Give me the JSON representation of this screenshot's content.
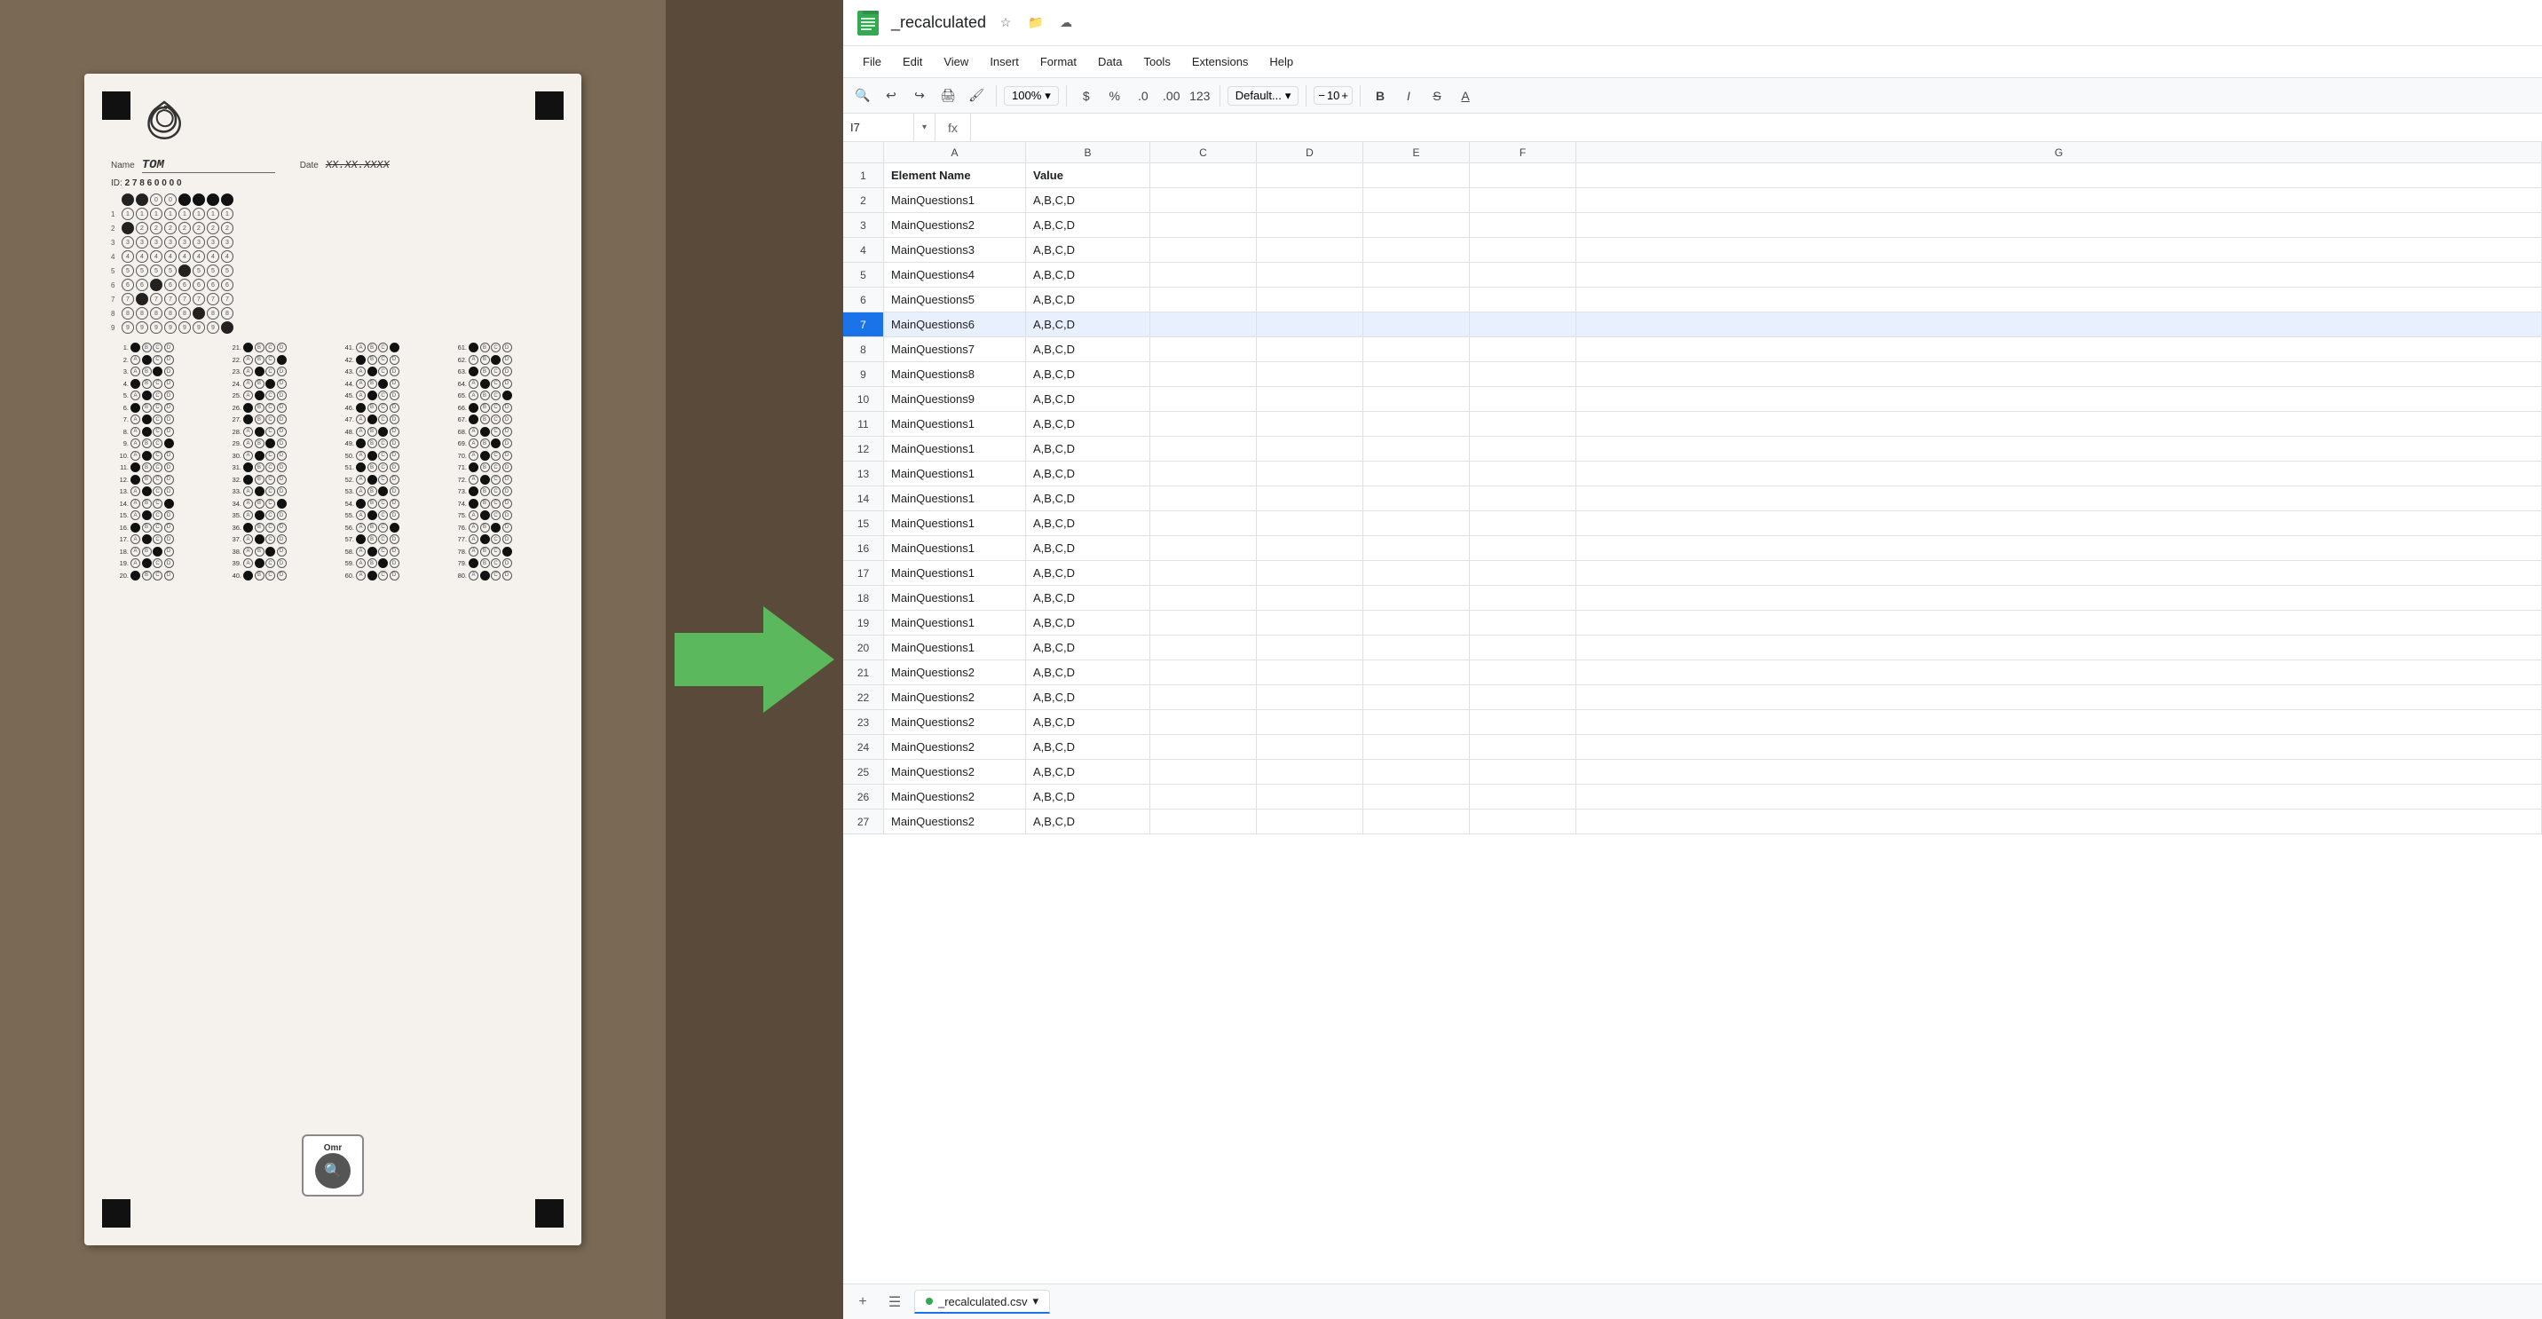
{
  "left_panel": {
    "name_label": "Name",
    "name_value": "TOM",
    "date_label": "Date",
    "date_value": "XX.XX.XXXX",
    "id_label": "ID:",
    "id_digits": "27860000"
  },
  "arrow": {
    "color": "#5cb85c"
  },
  "spreadsheet": {
    "title": "_recalculated",
    "file_name": "_recalculated.csv",
    "cell_ref": "I7",
    "menu": [
      "File",
      "Edit",
      "View",
      "Insert",
      "Format",
      "Data",
      "Tools",
      "Extensions",
      "Help"
    ],
    "toolbar": {
      "zoom": "100%",
      "font": "Default...",
      "font_size": "10",
      "bold": "B",
      "italic": "I",
      "strikethrough": "S",
      "underline": "U"
    },
    "columns": [
      "",
      "A",
      "B",
      "C",
      "D",
      "E",
      "F",
      "G"
    ],
    "rows": [
      {
        "num": 1,
        "a": "Element Name",
        "b": "Value"
      },
      {
        "num": 2,
        "a": "MainQuestions1",
        "b": "A,B,C,D"
      },
      {
        "num": 3,
        "a": "MainQuestions2",
        "b": "A,B,C,D"
      },
      {
        "num": 4,
        "a": "MainQuestions3",
        "b": "A,B,C,D"
      },
      {
        "num": 5,
        "a": "MainQuestions4",
        "b": "A,B,C,D"
      },
      {
        "num": 6,
        "a": "MainQuestions5",
        "b": "A,B,C,D"
      },
      {
        "num": 7,
        "a": "MainQuestions6",
        "b": "A,B,C,D",
        "selected": true
      },
      {
        "num": 8,
        "a": "MainQuestions7",
        "b": "A,B,C,D"
      },
      {
        "num": 9,
        "a": "MainQuestions8",
        "b": "A,B,C,D"
      },
      {
        "num": 10,
        "a": "MainQuestions9",
        "b": "A,B,C,D"
      },
      {
        "num": 11,
        "a": "MainQuestions1",
        "b": "A,B,C,D"
      },
      {
        "num": 12,
        "a": "MainQuestions1",
        "b": "A,B,C,D"
      },
      {
        "num": 13,
        "a": "MainQuestions1",
        "b": "A,B,C,D"
      },
      {
        "num": 14,
        "a": "MainQuestions1",
        "b": "A,B,C,D"
      },
      {
        "num": 15,
        "a": "MainQuestions1",
        "b": "A,B,C,D"
      },
      {
        "num": 16,
        "a": "MainQuestions1",
        "b": "A,B,C,D"
      },
      {
        "num": 17,
        "a": "MainQuestions1",
        "b": "A,B,C,D"
      },
      {
        "num": 18,
        "a": "MainQuestions1",
        "b": "A,B,C,D"
      },
      {
        "num": 19,
        "a": "MainQuestions1",
        "b": "A,B,C,D"
      },
      {
        "num": 20,
        "a": "MainQuestions1",
        "b": "A,B,C,D"
      },
      {
        "num": 21,
        "a": "MainQuestions2",
        "b": "A,B,C,D"
      },
      {
        "num": 22,
        "a": "MainQuestions2",
        "b": "A,B,C,D"
      },
      {
        "num": 23,
        "a": "MainQuestions2",
        "b": "A,B,C,D"
      },
      {
        "num": 24,
        "a": "MainQuestions2",
        "b": "A,B,C,D"
      },
      {
        "num": 25,
        "a": "MainQuestions2",
        "b": "A,B,C,D"
      },
      {
        "num": 26,
        "a": "MainQuestions2",
        "b": "A,B,C,D"
      },
      {
        "num": 27,
        "a": "MainQuestions2",
        "b": "A,B,C,D"
      }
    ]
  },
  "omr_watermark": "Omr",
  "questions": {
    "col1": [
      {
        "num": "1.",
        "bubbles": [
          "filled",
          "",
          "",
          ""
        ]
      },
      {
        "num": "2.",
        "bubbles": [
          "",
          "filled",
          "",
          ""
        ]
      },
      {
        "num": "3.",
        "bubbles": [
          "",
          "",
          "filled",
          ""
        ]
      },
      {
        "num": "4.",
        "bubbles": [
          "filled",
          "",
          "",
          ""
        ]
      },
      {
        "num": "5.",
        "bubbles": [
          "",
          "filled",
          "",
          ""
        ]
      },
      {
        "num": "6.",
        "bubbles": [
          "filled",
          "",
          "",
          ""
        ]
      },
      {
        "num": "7.",
        "bubbles": [
          "",
          "filled",
          "",
          ""
        ]
      },
      {
        "num": "8.",
        "bubbles": [
          "",
          "",
          "filled",
          ""
        ]
      },
      {
        "num": "9.",
        "bubbles": [
          "",
          "filled",
          "",
          ""
        ]
      },
      {
        "num": "10.",
        "bubbles": [
          "",
          "filled",
          "",
          ""
        ]
      },
      {
        "num": "11.",
        "bubbles": [
          "filled",
          "",
          "",
          ""
        ]
      },
      {
        "num": "12.",
        "bubbles": [
          "filled",
          "",
          "",
          ""
        ]
      },
      {
        "num": "13.",
        "bubbles": [
          "",
          "filled",
          "",
          ""
        ]
      },
      {
        "num": "14.",
        "bubbles": [
          "",
          "",
          "filled",
          ""
        ]
      },
      {
        "num": "15.",
        "bubbles": [
          "",
          "filled",
          "",
          ""
        ]
      },
      {
        "num": "16.",
        "bubbles": [
          "filled",
          "",
          "",
          ""
        ]
      },
      {
        "num": "17.",
        "bubbles": [
          "",
          "filled",
          "",
          ""
        ]
      },
      {
        "num": "18.",
        "bubbles": [
          "",
          "",
          "filled",
          ""
        ]
      },
      {
        "num": "19.",
        "bubbles": [
          "",
          "filled",
          "",
          ""
        ]
      },
      {
        "num": "20.",
        "bubbles": [
          "filled",
          "",
          "",
          ""
        ]
      }
    ]
  }
}
